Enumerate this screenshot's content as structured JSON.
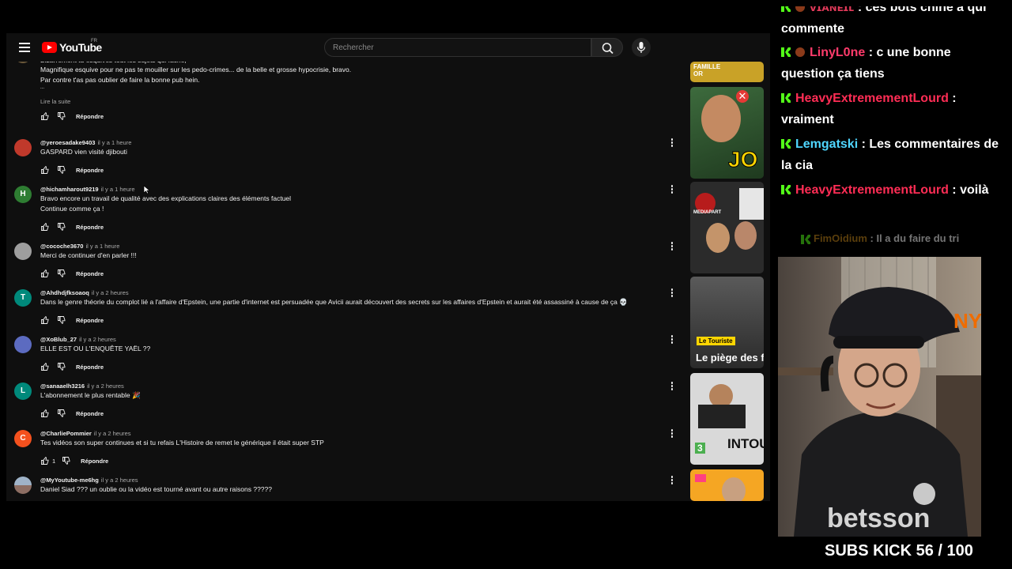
{
  "header": {
    "logo_text": "YouTube",
    "region": "FR",
    "search_placeholder": "Rechercher"
  },
  "comments": [
    {
      "lines": [
        "Bizarrement tu esquives tout les sujets qui fâche,",
        "Magnifique esquive pour ne pas te mouiller sur les pedo-crimes... de la belle et grosse hypocrisie, bravo.",
        "Par contre t'as pas oublier de faire la bonne pub hein.",
        "..."
      ],
      "read_more": "Lire la suite",
      "reply": "Répondre"
    },
    {
      "handle": "@yeroesadake9403",
      "time": "il y a 1 heure",
      "lines": [
        "GASPARD vien visité djibouti"
      ],
      "reply": "Répondre",
      "avatar_color": "#c0392b"
    },
    {
      "handle": "@hichamharout9219",
      "time": "il y a 1 heure",
      "lines": [
        "Bravo encore un travail de qualité avec des explications claires des éléments factuel",
        "Continue comme ça !"
      ],
      "reply": "Répondre",
      "avatar": "H",
      "avatar_color": "#2e7d32"
    },
    {
      "handle": "@cocoche3670",
      "time": "il y a 1 heure",
      "lines": [
        "Merci de continuer d'en parler !!!"
      ],
      "reply": "Répondre",
      "avatar_color": "#9e9e9e"
    },
    {
      "handle": "@Ahdhdjfksoaoq",
      "time": "il y a 2 heures",
      "lines": [
        "Dans le genre théorie du complot lié a l'affaire d'Epstein, une partie d'internet est persuadée que Avicii aurait découvert des secrets sur les affaires d'Epstein et aurait été assassiné à cause de ça 💀"
      ],
      "reply": "Répondre",
      "avatar": "T",
      "avatar_color": "#00897b"
    },
    {
      "handle": "@XoBlub_27",
      "time": "il y a 2 heures",
      "lines": [
        "ELLE EST OU L'ENQUÊTE YAËL ??"
      ],
      "reply": "Répondre",
      "avatar_color": "#5c6bc0"
    },
    {
      "handle": "@sanaaelh3216",
      "time": "il y a 2 heures",
      "lines": [
        "L'abonnement le plus rentable 🎉"
      ],
      "reply": "Répondre",
      "avatar": "L",
      "avatar_color": "#00897b"
    },
    {
      "handle": "@CharliePommier",
      "time": "il y a 2 heures",
      "lines": [
        "Tes vidéos son super continues et si tu refais L'Histoire de remet le générique il était super STP"
      ],
      "reply": "Répondre",
      "likes": "1",
      "avatar": "C",
      "avatar_color": "#f4511e"
    },
    {
      "handle": "@MyYoutube-me6hg",
      "time": "il y a 2 heures",
      "lines": [
        "Daniel Siad ??? un oublie ou la vidéo est tourné avant ou autre raisons ?????"
      ],
      "avatar_color": "#8d6e63"
    }
  ],
  "thumbnails": [
    {
      "label": "FAMILLE OR",
      "bg": "#c9a227"
    },
    {
      "label": "JO",
      "bg": "#2f4f2f"
    },
    {
      "label": "MEDIAPART",
      "bg": "#b71c1c"
    },
    {
      "label": "Le Touriste",
      "label2": "Le piège des f",
      "bg": "#3a3a3a"
    },
    {
      "label": "INTOU",
      "label2": "3",
      "bg": "#d9d9d9"
    },
    {
      "label": "",
      "bg": "#f5a623"
    }
  ],
  "chat": [
    {
      "user": "ᴠɪᴀɴᴇɪʟ",
      "user_color": "#e23a5a",
      "text": ": ces bots chine à qui commente"
    },
    {
      "user": "LinyL0ne",
      "user_color": "#ff3b6b",
      "text": ": c une bonne question ça tiens",
      "round_badge": true
    },
    {
      "user": "HeavyExtremementLourd",
      "user_color": "#ff2d55",
      "text": ": vraiment"
    },
    {
      "user": "Lemgatski",
      "user_color": "#4fd6ff",
      "text": ": Les commentaires de la cia"
    },
    {
      "user": "HeavyExtremementLourd",
      "user_color": "#ff2d55",
      "text": ": voilà"
    },
    {
      "user": "FimOidium",
      "user_color": "#c88a1c",
      "text": ": Il a du faire du tri"
    }
  ],
  "subs_counter": "SUBS KICK 56 / 100"
}
